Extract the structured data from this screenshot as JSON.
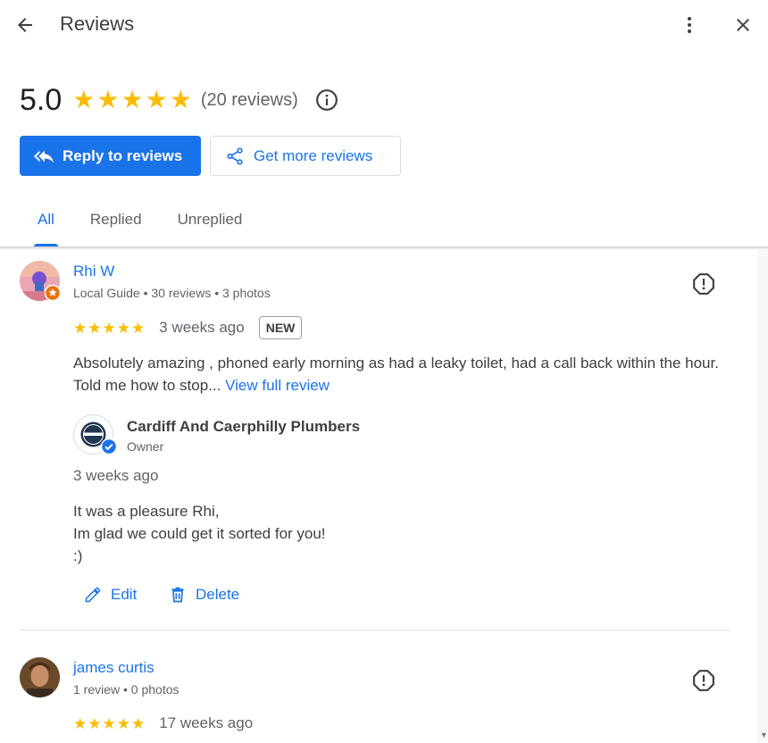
{
  "header": {
    "title": "Reviews"
  },
  "summary": {
    "rating": "5.0",
    "stars": 5,
    "count_text": "(20 reviews)"
  },
  "actions": {
    "reply_label": "Reply to reviews",
    "get_more_label": "Get more reviews"
  },
  "tabs": [
    {
      "label": "All",
      "active": true
    },
    {
      "label": "Replied",
      "active": false
    },
    {
      "label": "Unreplied",
      "active": false
    }
  ],
  "reviews": [
    {
      "name": "Rhi W",
      "meta": "Local Guide • 30 reviews • 3 photos",
      "stars": 5,
      "time": "3 weeks ago",
      "badge": "NEW",
      "text": "Absolutely amazing , phoned early morning as had a leaky toilet, had a call back within the hour. Told me how to stop...",
      "view_full": "View full review",
      "reply": {
        "owner_name": "Cardiff And Caerphilly Plumbers",
        "owner_role": "Owner",
        "time": "3 weeks ago",
        "text": "It was a pleasure Rhi,\nIm glad we could get it sorted for you!\n:)",
        "edit_label": "Edit",
        "delete_label": "Delete"
      }
    },
    {
      "name": "james curtis",
      "meta": "1 review • 0 photos",
      "stars": 5,
      "time": "17 weeks ago"
    }
  ],
  "colors": {
    "accent": "#1a73e8",
    "star": "#fbbc04",
    "local_guide_badge": "#e8710a"
  }
}
